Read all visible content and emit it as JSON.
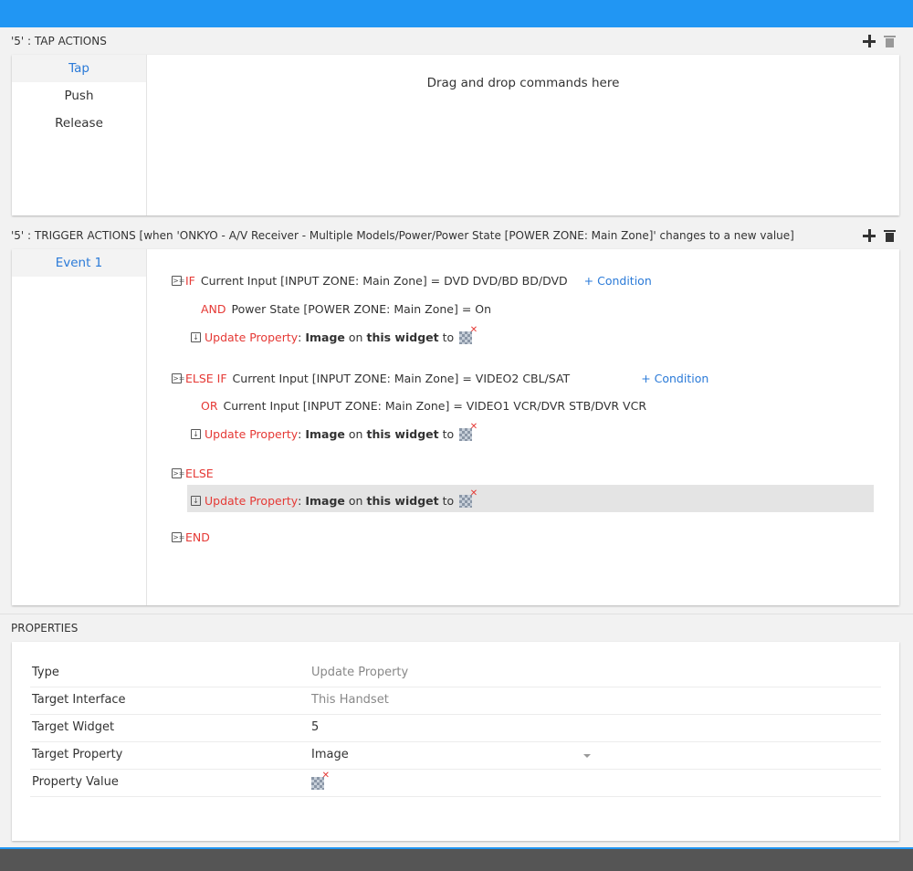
{
  "tap_section": {
    "title": "'5' : TAP ACTIONS",
    "tabs": [
      "Tap",
      "Push",
      "Release"
    ],
    "dropzone_text": "Drag and drop commands here"
  },
  "trigger_section": {
    "title": "'5' : TRIGGER ACTIONS [when 'ONKYO - A/V Receiver - Multiple Models/Power/Power State [POWER ZONE: Main Zone]' changes to a new value]",
    "events": [
      "Event 1"
    ],
    "if_kw": "IF",
    "if_cond": "Current Input [INPUT ZONE: Main Zone] = DVD DVD/BD BD/DVD",
    "add_condition": "+ Condition",
    "and_kw": "AND",
    "and_cond": "Power State [POWER ZONE: Main Zone] = On",
    "elseif_kw": "ELSE IF",
    "elseif_cond": "Current Input [INPUT ZONE: Main Zone] = VIDEO2 CBL/SAT",
    "or_kw": "OR",
    "or_cond": "Current Input [INPUT ZONE: Main Zone] = VIDEO1 VCR/DVR STB/DVR VCR",
    "else_kw": "ELSE",
    "end_kw": "END",
    "action": {
      "update_label": "Update Property",
      "colon": ":",
      "property": "Image",
      "on": "on",
      "target": "this widget",
      "to": "to"
    }
  },
  "properties": {
    "header": "PROPERTIES",
    "rows": [
      {
        "key": "Type",
        "value": "Update Property"
      },
      {
        "key": "Target Interface",
        "value": "This Handset"
      },
      {
        "key": "Target Widget",
        "value": "5"
      },
      {
        "key": "Target Property",
        "value": "Image"
      },
      {
        "key": "Property Value",
        "value": ""
      }
    ]
  },
  "colors": {
    "accent": "#2196f3",
    "keyword": "#e53935",
    "link": "#2a7ad8"
  }
}
